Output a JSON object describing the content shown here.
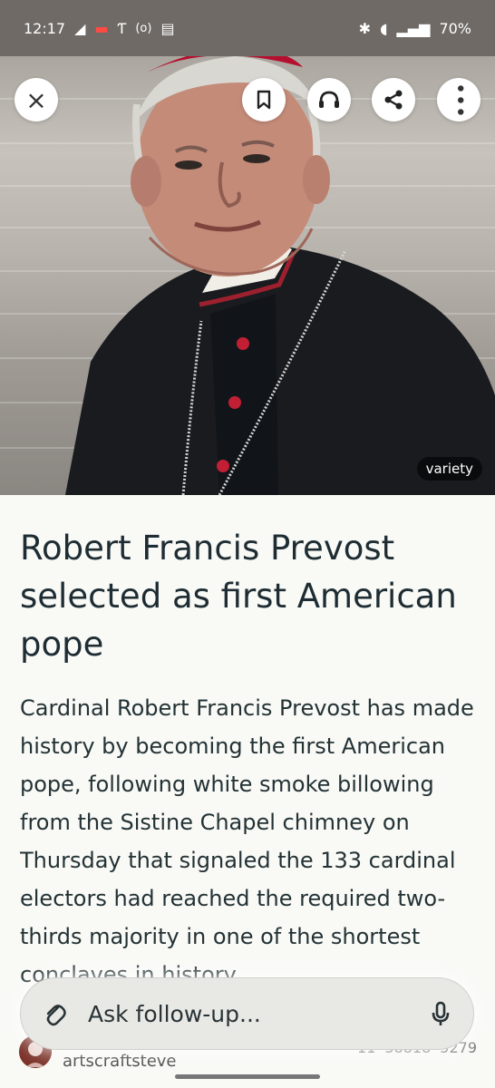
{
  "status": {
    "time": "12:17",
    "left_icons": [
      "telegram-icon",
      "red-notification-icon",
      "antenna-icon",
      "wireless-icon",
      "sim-icon"
    ],
    "right_icons": [
      "bluetooth-icon",
      "wifi-icon",
      "signal-icon"
    ],
    "battery": "70%"
  },
  "hero": {
    "source": "variety",
    "buttons": {
      "close": "close-icon",
      "bookmark": "bookmark-icon",
      "listen": "headphones-icon",
      "share": "share-icon",
      "more": "more-vert-icon"
    }
  },
  "article": {
    "title": "Robert Francis Prevost selected as first American pope",
    "body": "Cardinal Robert Francis Prevost has made history by becoming the first American pope, following white smoke billowing from the Sistine Chapel chimney on Thursday that signaled the 133 cardinal electors had reached the required two-thirds majority in one of the shortest conclaves in history."
  },
  "followup": {
    "label": "Ask follow-up...",
    "left_icon": "attachment-icon",
    "right_icon": "microphone-icon"
  },
  "footer": {
    "author": "artscraftsteve",
    "stats": [
      "11",
      "38818",
      "5279"
    ]
  }
}
